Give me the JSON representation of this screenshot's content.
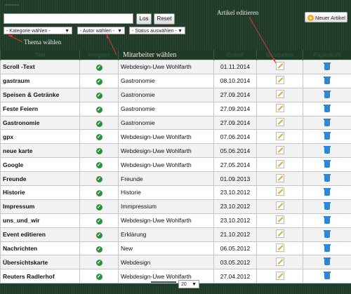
{
  "toolbar": {
    "search_value": "",
    "go_label": "Los",
    "reset_label": "Reset",
    "category_select": "- Kategorie wählen -",
    "author_select": "- Autor wählen -",
    "status_select": "- Status auswählen -",
    "new_article_label": "Neuer Artikel"
  },
  "annotations": {
    "edit_article": "Artikel editieren",
    "choose_topic": "Thema wählen",
    "choose_employee": "Mitarbeiter wählen"
  },
  "table": {
    "columns": [
      "Titel",
      "Freigabe",
      "Mitarbeiter wählen",
      "Erstellt",
      "Bearbeiten",
      "Papierkorb"
    ],
    "rows": [
      {
        "title": "Scroll -Text",
        "author": "Webdesign-Uwe Wohlfarth",
        "created": "01.11.2014"
      },
      {
        "title": "gastraum",
        "author": "Gastronomie",
        "created": "08.10.2014"
      },
      {
        "title": "Speisen & Getränke",
        "author": "Gastronomie",
        "created": "27.09.2014"
      },
      {
        "title": "Feste Feiern",
        "author": "Gastronomie",
        "created": "27.09.2014"
      },
      {
        "title": "Gastronomie",
        "author": "Gastronomie",
        "created": "27.09.2014"
      },
      {
        "title": "gpx",
        "author": "Webdesign-Uwe Wohlfarth",
        "created": "07.06.2014"
      },
      {
        "title": "neue karte",
        "author": "Webdesign-Uwe Wohlfarth",
        "created": "05.06.2014"
      },
      {
        "title": "Google",
        "author": "Webdesign-Uwe Wohlfarth",
        "created": "27.05.2014"
      },
      {
        "title": "Freunde",
        "author": "Freunde",
        "created": "01.09.2013"
      },
      {
        "title": "Historie",
        "author": "Historie",
        "created": "23.10.2012"
      },
      {
        "title": "Impressum",
        "author": "Immpressium",
        "created": "23.10.2012"
      },
      {
        "title": "uns_und_wir",
        "author": "Webdesign-Uwe Wohlfarth",
        "created": "23.10.2012"
      },
      {
        "title": "Event editieren",
        "author": "Erklärung",
        "created": "21.10.2012"
      },
      {
        "title": "Nachrichten",
        "author": "New",
        "created": "06.05.2012"
      },
      {
        "title": "Übersichtskarte",
        "author": "Webdesign",
        "created": "03.05.2012"
      },
      {
        "title": "Reuters Radlerhof",
        "author": "Webdesign-Uwe Wohlfarth",
        "created": "27.04.2012"
      }
    ]
  },
  "pager": {
    "per_page": "20"
  },
  "colors": {
    "background": "#1f3a27",
    "check": "#2f8f3c",
    "trash": "#2f86d6",
    "annotation_arrow": "#d43a3a"
  },
  "icons": [
    "check-icon",
    "pencil-icon",
    "trash-icon",
    "plus-icon"
  ]
}
